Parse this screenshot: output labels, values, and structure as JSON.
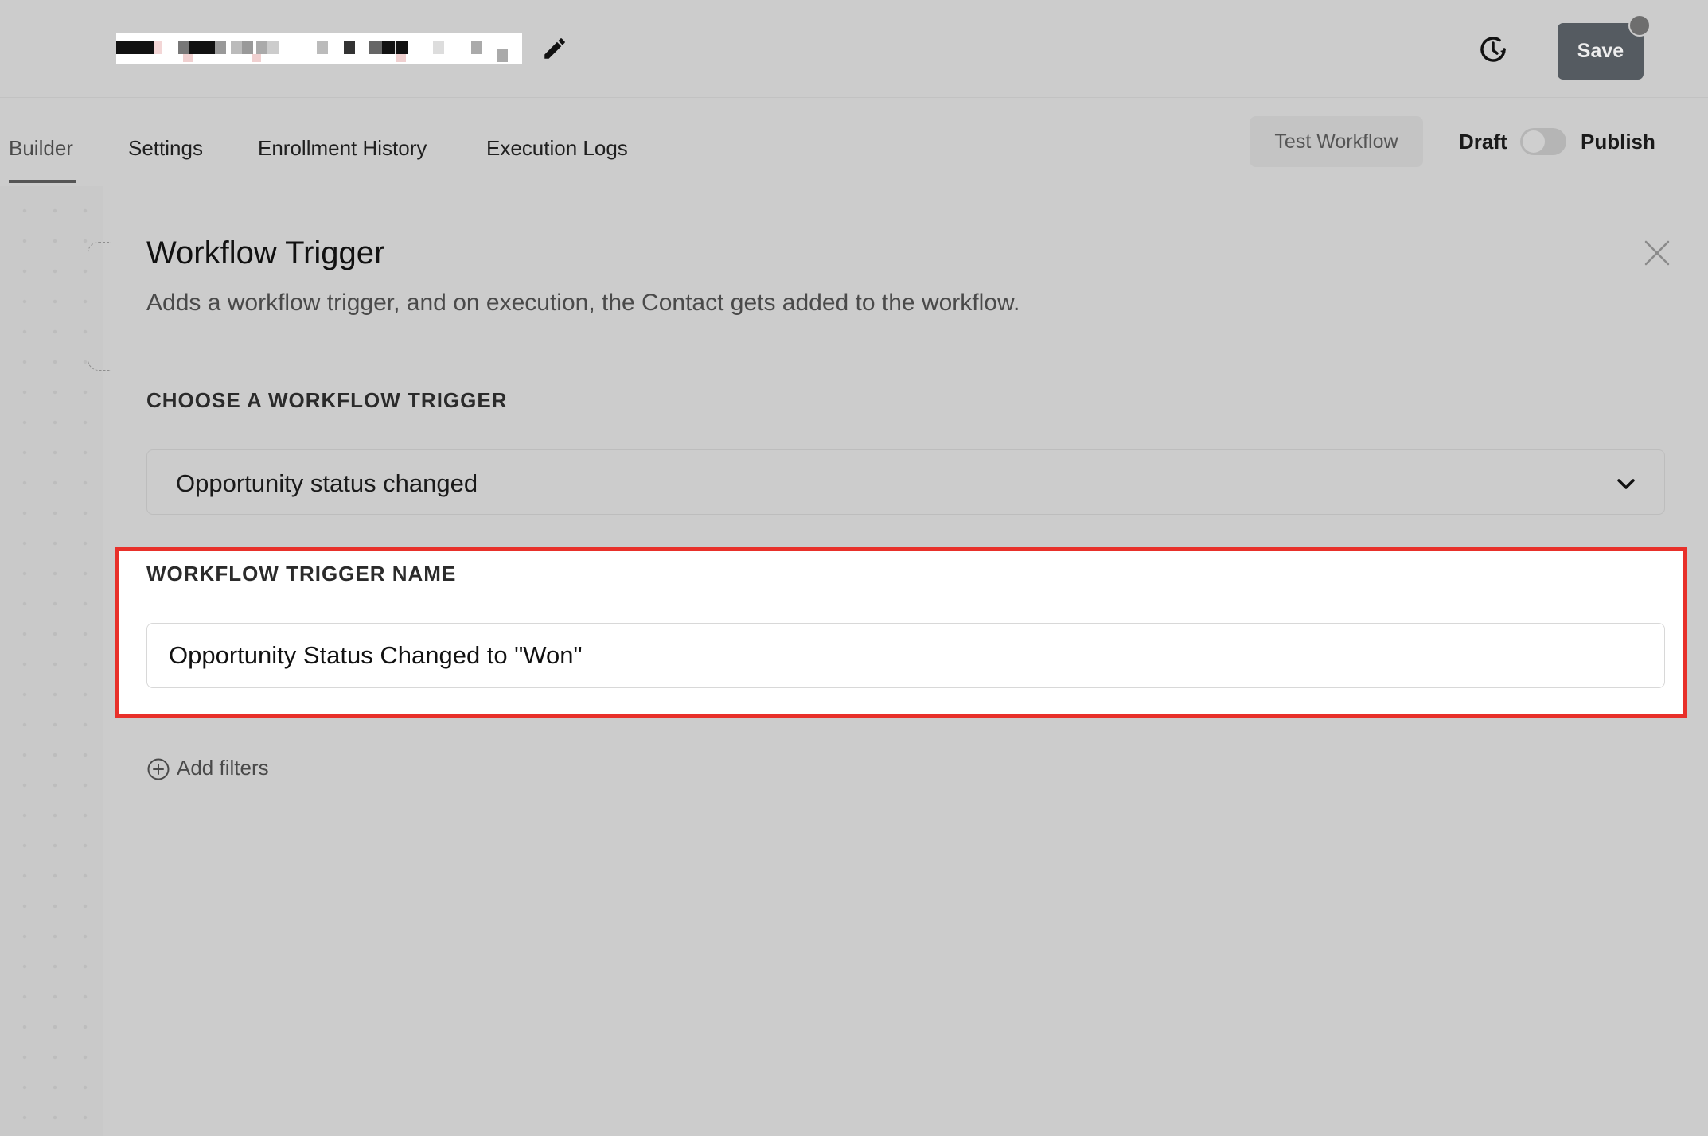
{
  "header": {
    "save_label": "Save"
  },
  "tabs": [
    {
      "label": "Builder"
    },
    {
      "label": "Settings"
    },
    {
      "label": "Enrollment History"
    },
    {
      "label": "Execution Logs"
    }
  ],
  "toolbar": {
    "test_workflow_label": "Test Workflow",
    "draft_label": "Draft",
    "publish_label": "Publish",
    "published": false
  },
  "panel": {
    "title": "Workflow Trigger",
    "subtitle": "Adds a workflow trigger, and on execution, the Contact gets added to the workflow.",
    "choose_label": "CHOOSE A WORKFLOW TRIGGER",
    "selected_trigger": "Opportunity status changed",
    "name_label": "WORKFLOW TRIGGER NAME",
    "trigger_name_value": "Opportunity Status Changed to \"Won\"",
    "add_filters_label": "Add filters"
  },
  "icons": {
    "edit": "pencil-icon",
    "history": "history-icon",
    "close": "close-icon",
    "dropdown": "chevron-down-icon",
    "add": "plus-circle-icon"
  },
  "colors": {
    "highlight_border": "#e8302a",
    "save_button": "#555b61"
  }
}
